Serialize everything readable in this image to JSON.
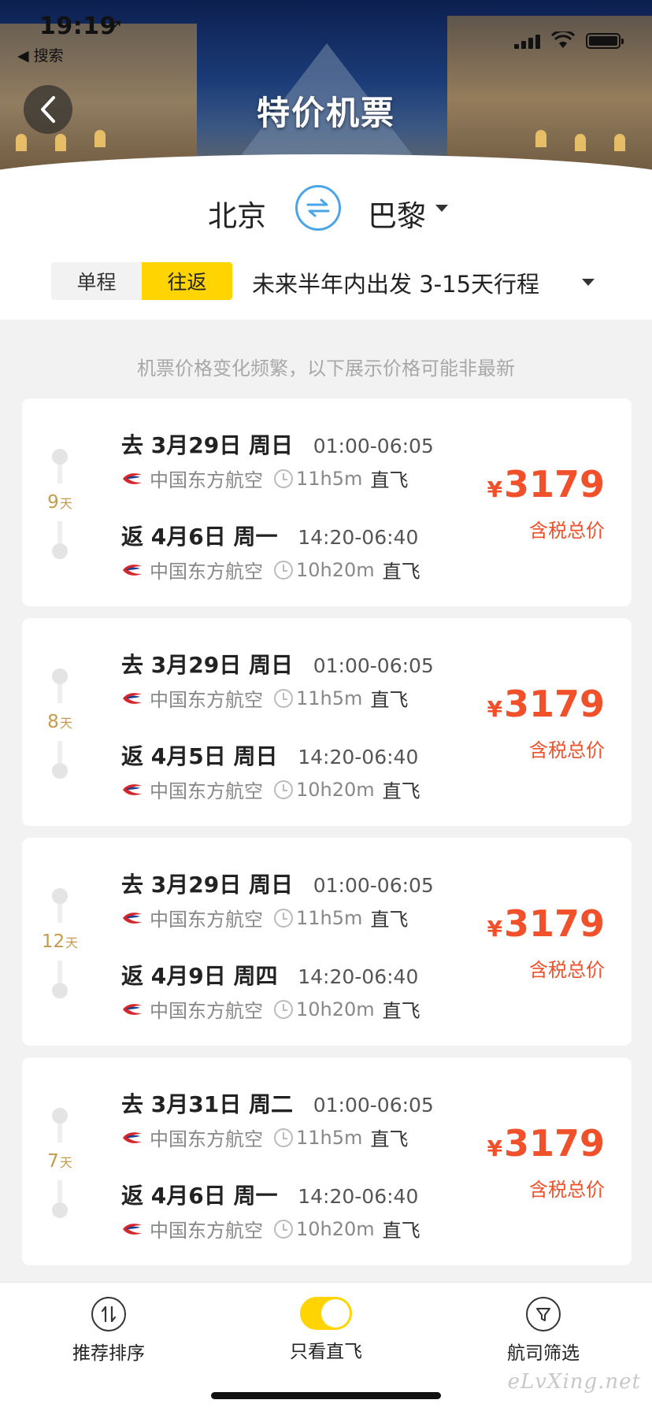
{
  "status_bar": {
    "time": "19:19",
    "location_arrow": "➚",
    "back_app": "◀ 搜索"
  },
  "header": {
    "title": "特价机票",
    "back_icon": "chevron-left-icon"
  },
  "route": {
    "from": "北京",
    "to": "巴黎",
    "swap_icon": "swap-arrows-icon",
    "trip_types": [
      "单程",
      "往返"
    ],
    "selected_trip_type": "往返",
    "date_range": "未来半年内出发 3-15天行程"
  },
  "notice": "机票价格变化频繁，以下展示价格可能非最新",
  "colors": {
    "accent_yellow": "#ffd400",
    "price_red": "#f0502a",
    "days_gold": "#c59a4c",
    "swap_blue": "#4aa6e8"
  },
  "offers": [
    {
      "days": "9",
      "days_unit": "天",
      "outbound": {
        "prefix": "去",
        "date": "3月29日 周日",
        "time": "01:00-06:05",
        "airline": "中国东方航空",
        "duration": "11h5m",
        "type": "直飞"
      },
      "return": {
        "prefix": "返",
        "date": "4月6日 周一",
        "time": "14:20-06:40",
        "airline": "中国东方航空",
        "duration": "10h20m",
        "type": "直飞"
      },
      "currency": "¥",
      "price": "3179",
      "price_label": "含税总价"
    },
    {
      "days": "8",
      "days_unit": "天",
      "outbound": {
        "prefix": "去",
        "date": "3月29日 周日",
        "time": "01:00-06:05",
        "airline": "中国东方航空",
        "duration": "11h5m",
        "type": "直飞"
      },
      "return": {
        "prefix": "返",
        "date": "4月5日 周日",
        "time": "14:20-06:40",
        "airline": "中国东方航空",
        "duration": "10h20m",
        "type": "直飞"
      },
      "currency": "¥",
      "price": "3179",
      "price_label": "含税总价"
    },
    {
      "days": "12",
      "days_unit": "天",
      "outbound": {
        "prefix": "去",
        "date": "3月29日 周日",
        "time": "01:00-06:05",
        "airline": "中国东方航空",
        "duration": "11h5m",
        "type": "直飞"
      },
      "return": {
        "prefix": "返",
        "date": "4月9日 周四",
        "time": "14:20-06:40",
        "airline": "中国东方航空",
        "duration": "10h20m",
        "type": "直飞"
      },
      "currency": "¥",
      "price": "3179",
      "price_label": "含税总价"
    },
    {
      "days": "7",
      "days_unit": "天",
      "outbound": {
        "prefix": "去",
        "date": "3月31日 周二",
        "time": "01:00-06:05",
        "airline": "中国东方航空",
        "duration": "11h5m",
        "type": "直飞"
      },
      "return": {
        "prefix": "返",
        "date": "4月6日 周一",
        "time": "14:20-06:40",
        "airline": "中国东方航空",
        "duration": "10h20m",
        "type": "直飞"
      },
      "currency": "¥",
      "price": "3179",
      "price_label": "含税总价"
    }
  ],
  "bottom_bar": {
    "sort_label": "推荐排序",
    "sort_icon": "sort-arrows-icon",
    "direct_only_label": "只看直飞",
    "direct_only_on": true,
    "filter_label": "航司筛选",
    "filter_icon": "filter-funnel-icon"
  },
  "watermark": "eLvXing.net"
}
